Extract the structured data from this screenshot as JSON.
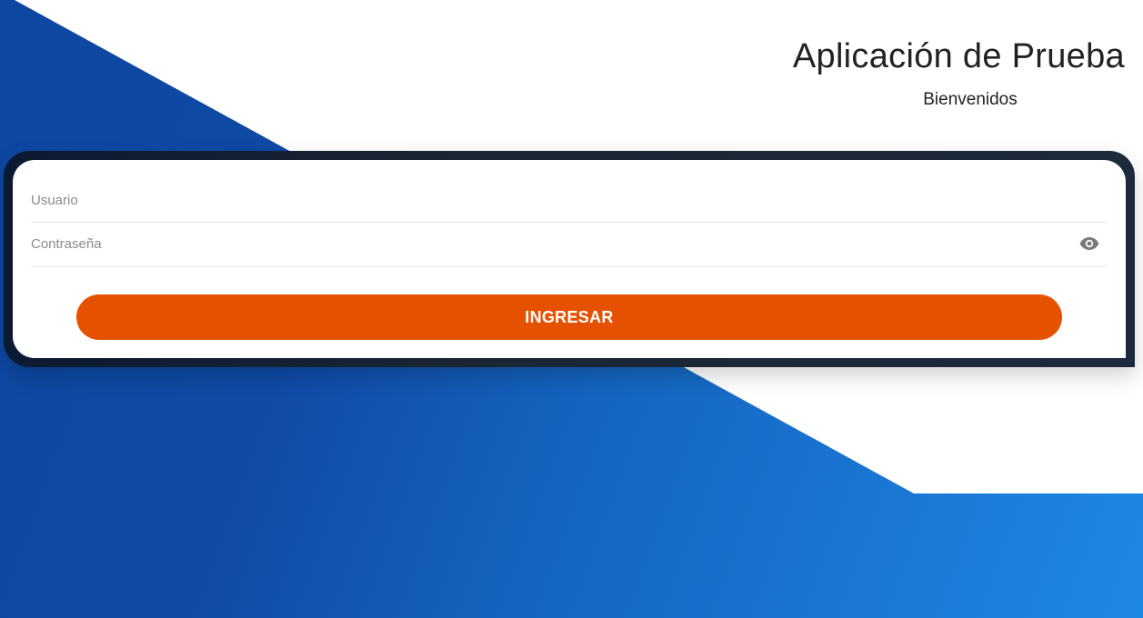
{
  "header": {
    "title": "Aplicación de Prueba",
    "subtitle": "Bienvenidos"
  },
  "form": {
    "username": {
      "placeholder": "Usuario",
      "value": ""
    },
    "password": {
      "placeholder": "Contraseña",
      "value": "",
      "toggle_icon": "eye-icon"
    },
    "submit_label": "INGRESAR"
  },
  "colors": {
    "primary_button": "#e65100",
    "background_blue_dark": "#0d47a1",
    "background_blue_light": "#1e88e5",
    "card_frame": "#1b2533"
  }
}
